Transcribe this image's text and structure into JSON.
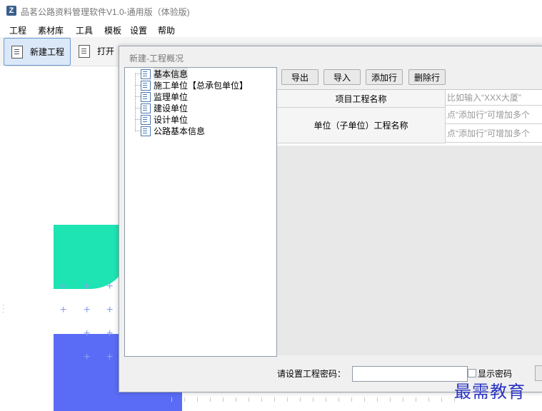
{
  "app": {
    "logo_letter": "Z",
    "title": "品茗公路资料管理软件V1.0-通用版（体验版)"
  },
  "menu": [
    "工程",
    "素材库",
    "工具",
    "模板",
    "设置",
    "帮助"
  ],
  "toolbar": {
    "new_project": "新建工程",
    "open": "打开"
  },
  "dialog": {
    "title": "新建-工程概况",
    "tree": [
      {
        "label": "基本信息",
        "selected": true
      },
      {
        "label": "施工单位【总承包单位】"
      },
      {
        "label": "监理单位"
      },
      {
        "label": "建设单位"
      },
      {
        "label": "设计单位"
      },
      {
        "label": "公路基本信息"
      }
    ],
    "buttons": {
      "export": "导出",
      "import": "导入",
      "add_row": "添加行",
      "delete_row": "删除行"
    },
    "grid": {
      "project_name_label": "项目工程名称",
      "project_name_placeholder": "比如输入“XXX大厦”",
      "unit_name_label": "单位（子单位）工程名称",
      "unit_hint_1": "点“添加行”可增加多个",
      "unit_hint_2": "点“添加行”可增加多个"
    },
    "password_label": "请设置工程密码：",
    "password_value": "",
    "show_password": "显示密码"
  },
  "watermark": "最需教育"
}
